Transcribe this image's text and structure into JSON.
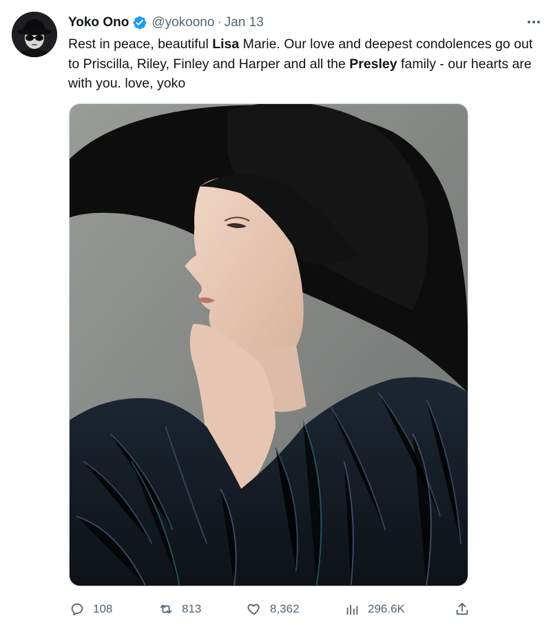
{
  "author": {
    "name": "Yoko Ono",
    "handle": "@yokoono",
    "separator": "·",
    "date": "Jan 13",
    "avatar_icon": "avatar-person-hat-sunglasses",
    "verified_icon": "verified-badge-icon"
  },
  "tweet": {
    "segments": [
      {
        "text": "Rest in peace, beautiful ",
        "bold": false
      },
      {
        "text": "Lisa",
        "bold": true
      },
      {
        "text": " Marie. Our love and deepest condolences go out to Priscilla,  Riley, Finley and Harper and all the ",
        "bold": false
      },
      {
        "text": "Presley",
        "bold": true
      },
      {
        "text": " family - our hearts are with you. love, yoko",
        "bold": false
      }
    ]
  },
  "media": {
    "alt": "Portrait photo of a woman in a wide-brimmed black hat and a feather coat, chin resting on her hand"
  },
  "actions": {
    "reply_count": "108",
    "retweet_count": "813",
    "like_count": "8,362",
    "views_count": "296.6K"
  },
  "colors": {
    "accent": "#1d9bf0",
    "secondary_text": "#536471",
    "primary_text": "#0f1419"
  }
}
